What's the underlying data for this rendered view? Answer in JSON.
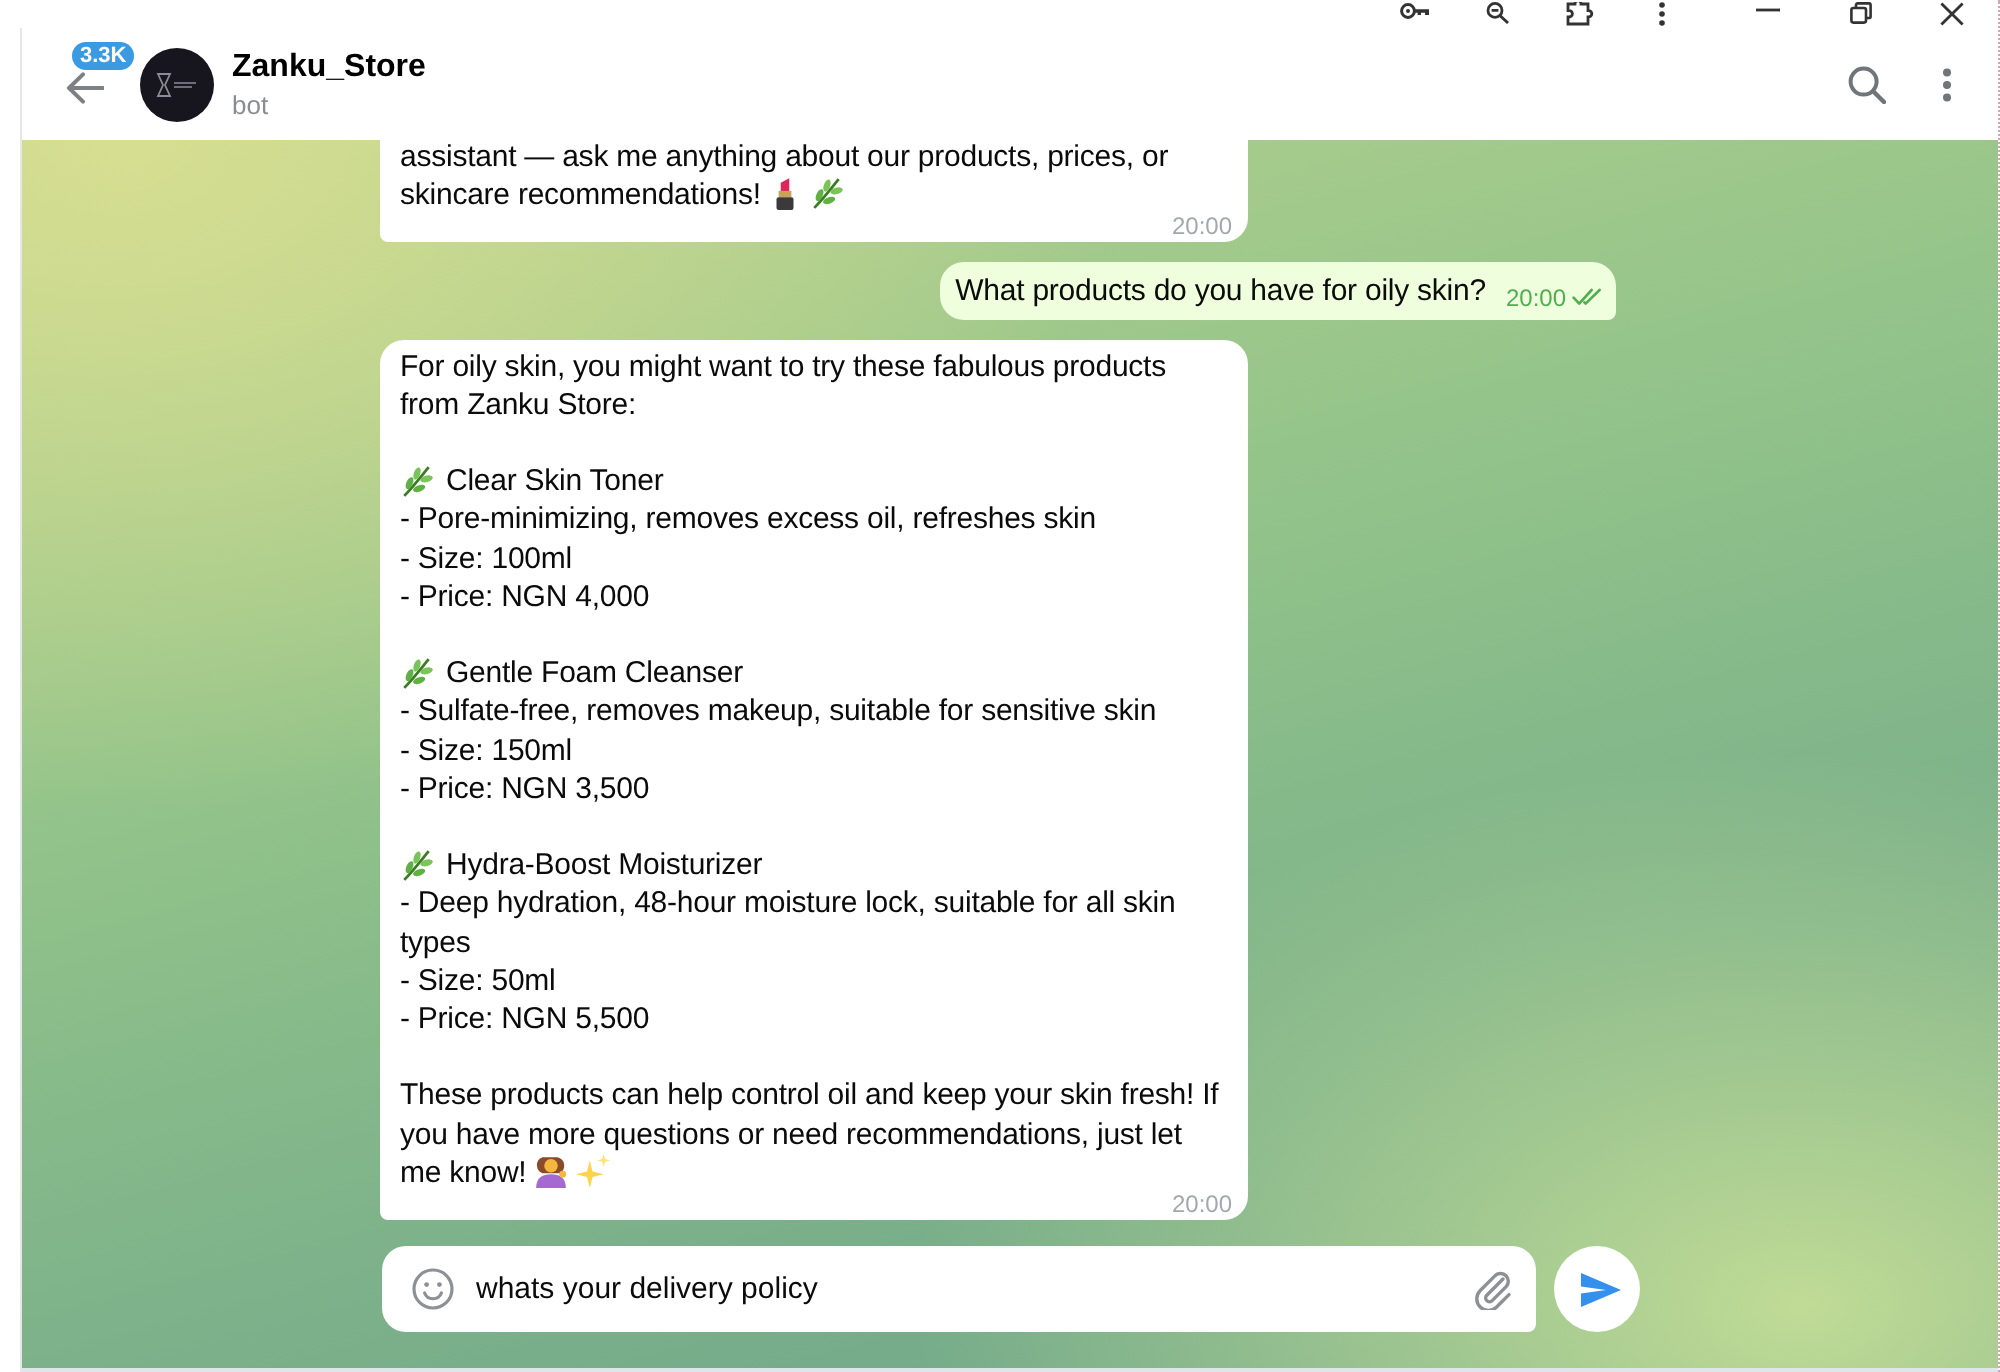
{
  "header": {
    "unread_badge": "3.3K",
    "title": "Zanku_Store",
    "subtitle": "bot"
  },
  "messages": [
    {
      "kind": "incoming",
      "blocks": [
        {
          "kind": "paragraph",
          "text": "assistant — ask me anything about our products, prices, or skincare recommendations!"
        }
      ],
      "time": "20:00"
    },
    {
      "kind": "outgoing",
      "blocks": [
        {
          "kind": "paragraph",
          "text": "What products do you have for oily skin?"
        }
      ],
      "time": "20:00",
      "read": true
    },
    {
      "kind": "incoming",
      "blocks": [
        {
          "kind": "paragraph",
          "text": "For oily skin, you might want to try these fabulous products from Zanku Store:"
        },
        {
          "kind": "product",
          "name": "Clear Skin Toner",
          "details": [
            "- Pore-minimizing, removes excess oil, refreshes skin",
            "- Size: 100ml",
            "- Price: NGN 4,000"
          ]
        },
        {
          "kind": "product",
          "name": "Gentle Foam Cleanser",
          "details": [
            "- Sulfate-free, removes makeup, suitable for sensitive skin",
            "- Size: 150ml",
            "- Price: NGN 3,500"
          ]
        },
        {
          "kind": "product",
          "name": "Hydra-Boost Moisturizer",
          "details": [
            "- Deep hydration, 48-hour moisture lock, suitable for all skin types",
            "- Size: 50ml",
            "- Price: NGN 5,500"
          ]
        },
        {
          "kind": "paragraph",
          "text": "These products can help control oil and keep your skin fresh! If you have more questions or need recommendations, just let me know!"
        }
      ],
      "time": "20:00"
    }
  ],
  "composer": {
    "value": "whats your delivery policy"
  }
}
